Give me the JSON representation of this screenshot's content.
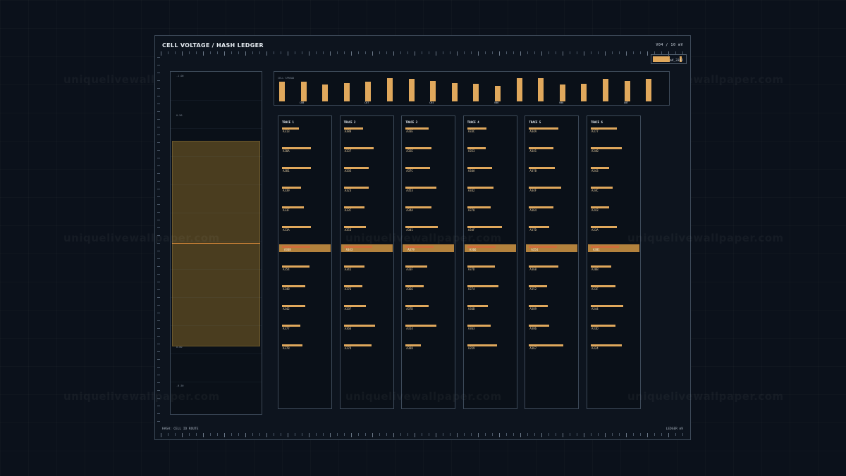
{
  "window": {
    "title": "CELL VOLTAGE  /  HASH LEDGER",
    "scale_label": "V04 / 10  mV"
  },
  "zoom": {
    "readout": "mV_3342",
    "fill_fraction": 0.55
  },
  "footer": {
    "left": "HASH: CELL ID  ROUTE",
    "right": "LEDGER  mV"
  },
  "voltage_panel": {
    "tick_labels": [
      "-1.00",
      "0.50",
      "0.00",
      "-0.50"
    ],
    "level_fraction": 0.62
  },
  "bar_panel": {
    "title": "CELL SPREAD",
    "values": [
      0.85,
      0.85,
      0.72,
      0.78,
      0.85,
      1.0,
      0.98,
      0.88,
      0.8,
      0.75,
      0.68,
      1.0,
      1.0,
      0.72,
      0.75,
      0.97,
      0.88,
      0.98
    ],
    "labels": [
      "C08",
      "C07",
      "C04",
      "V06",
      "V06",
      "U07"
    ]
  },
  "traces": [
    {
      "title": "TRACE 1",
      "selected": "A368",
      "rows": [
        [
          "A313",
          0.35
        ],
        [
          "A38A",
          0.6
        ],
        [
          "A381",
          0.6
        ],
        [
          "A339",
          0.4
        ],
        [
          "A33F",
          0.45
        ],
        [
          "A33A",
          0.6
        ],
        [
          "A354",
          0.58
        ],
        [
          "A348",
          0.48
        ],
        [
          "A342",
          0.48
        ],
        [
          "A377",
          0.38
        ],
        [
          "A378",
          0.42
        ]
      ]
    },
    {
      "title": "TRACE 2",
      "selected": "A343",
      "rows": [
        [
          "A388",
          0.4
        ],
        [
          "A337",
          0.62
        ],
        [
          "A33E",
          0.52
        ],
        [
          "A323",
          0.52
        ],
        [
          "A33C",
          0.42
        ],
        [
          "A353",
          0.45
        ],
        [
          "A341",
          0.42
        ],
        [
          "A376",
          0.38
        ],
        [
          "A33F",
          0.45
        ],
        [
          "A366",
          0.65
        ],
        [
          "A37D",
          0.58
        ]
      ]
    },
    {
      "title": "TRACE 3",
      "selected": "A379",
      "rows": [
        [
          "A33E",
          0.48
        ],
        [
          "A32E",
          0.55
        ],
        [
          "A37C",
          0.52
        ],
        [
          "A353",
          0.65
        ],
        [
          "A34A",
          0.55
        ],
        [
          "A341",
          0.68
        ],
        [
          "A33F",
          0.45
        ],
        [
          "A366",
          0.38
        ],
        [
          "A37D",
          0.48
        ],
        [
          "A314",
          0.65
        ],
        [
          "A388",
          0.32
        ]
      ]
    },
    {
      "title": "TRACE 4",
      "selected": "A366",
      "rows": [
        [
          "A33C",
          0.4
        ],
        [
          "A353",
          0.38
        ],
        [
          "A34A",
          0.52
        ],
        [
          "A342",
          0.55
        ],
        [
          "A378",
          0.48
        ],
        [
          "A34F",
          0.72
        ],
        [
          "A37D",
          0.58
        ],
        [
          "A374",
          0.65
        ],
        [
          "A36B",
          0.42
        ],
        [
          "A363",
          0.48
        ],
        [
          "A359",
          0.62
        ]
      ]
    },
    {
      "title": "TRACE 5",
      "selected": "A354",
      "rows": [
        [
          "A34A",
          0.62
        ],
        [
          "A341",
          0.52
        ],
        [
          "A378",
          0.55
        ],
        [
          "A34F",
          0.68
        ],
        [
          "A364",
          0.52
        ],
        [
          "A37D",
          0.42
        ],
        [
          "A368",
          0.62
        ],
        [
          "A352",
          0.38
        ],
        [
          "A389",
          0.4
        ],
        [
          "A386",
          0.42
        ],
        [
          "A367",
          0.72
        ]
      ]
    },
    {
      "title": "TRACE 6",
      "selected": "A381",
      "rows": [
        [
          "A377",
          0.55
        ],
        [
          "A340",
          0.65
        ],
        [
          "A343",
          0.38
        ],
        [
          "A34C",
          0.45
        ],
        [
          "A343",
          0.38
        ],
        [
          "A33A",
          0.55
        ],
        [
          "A38B",
          0.42
        ],
        [
          "A33F",
          0.52
        ],
        [
          "A344",
          0.68
        ],
        [
          "A33D",
          0.52
        ],
        [
          "A324",
          0.65
        ]
      ]
    }
  ],
  "watermark": "uniquelivewallpaper.com"
}
